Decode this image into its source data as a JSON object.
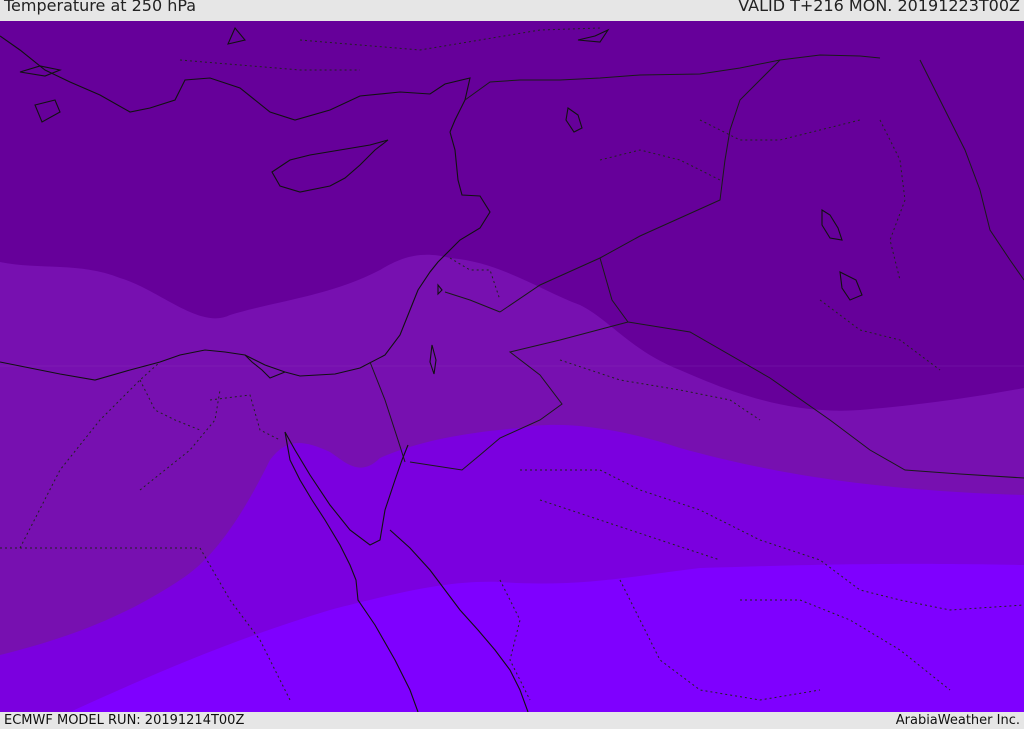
{
  "header": {
    "title": "Temperature at 250 hPa",
    "valid": "VALID T+216 MON. 20191223T00Z"
  },
  "footer": {
    "model_run": "ECMWF MODEL RUN: 20191214T00Z",
    "credit": "ArabiaWeather Inc."
  },
  "colors": {
    "band_coldest": "#66009a",
    "band_2": "#7710b0",
    "band_3": "#7b00df",
    "band_warmest": "#7f00ff",
    "coast_line": "#111111",
    "border_line": "#222222",
    "chrome_bg": "#e6e6e6"
  }
}
